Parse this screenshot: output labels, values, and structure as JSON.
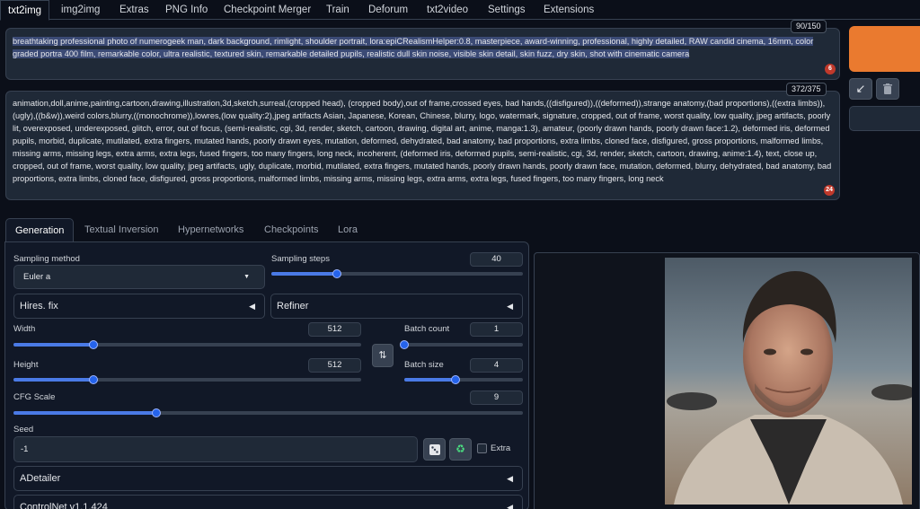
{
  "tabs": [
    "txt2img",
    "img2img",
    "Extras",
    "PNG Info",
    "Checkpoint Merger",
    "Train",
    "Deforum",
    "txt2video",
    "Settings",
    "Extensions"
  ],
  "prompt": {
    "text_selected": "breathtaking professional photo of numerogeek man, dark background, rimlight, shoulder portrait, lora:epiCRealismHelper:0.8, masterpiece, award-winning, professional, highly detailed, RAW candid cinema, 16mm, color graded portra 400 film, remarkable color, ultra realistic, textured skin, remarkable detailed pupils, realistic dull skin noise, visible skin detail, skin fuzz, dry skin, shot with cinematic camera",
    "token_counter": "90/150",
    "badge": "6"
  },
  "negative_prompt": {
    "text": "animation,doll,anime,painting,cartoon,drawing,illustration,3d,sketch,surreal,(cropped head), (cropped body),out of frame,crossed eyes, bad hands,((disfigured)),((deformed)),strange anatomy,(bad proportions),((extra limbs)),(ugly),((b&w)),weird colors,blurry,((monochrome)),lowres,(low quality:2),jpeg artifacts Asian, Japanese, Korean, Chinese, blurry, logo, watermark, signature, cropped, out of frame, worst quality, low quality, jpeg artifacts, poorly lit, overexposed, underexposed, glitch, error, out of focus, (semi-realistic, cgi, 3d, render, sketch, cartoon, drawing, digital art, anime, manga:1.3), amateur, (poorly drawn hands, poorly drawn face:1.2), deformed iris, deformed pupils, morbid, duplicate, mutilated, extra fingers, mutated hands, poorly drawn eyes, mutation, deformed, dehydrated, bad anatomy, bad proportions, extra limbs, cloned face, disfigured, gross proportions, malformed limbs, missing arms, missing legs, extra arms, extra legs, fused fingers, too many fingers, long neck, incoherent, (deformed iris, deformed pupils, semi-realistic, cgi, 3d, render, sketch, cartoon, drawing, anime:1.4), text, close up, cropped, out of frame, worst quality, low quality, jpeg artifacts, ugly, duplicate, morbid, mutilated, extra fingers, mutated hands, poorly drawn hands, poorly drawn face, mutation, deformed, blurry, dehydrated, bad anatomy, bad proportions, extra limbs, cloned face, disfigured, gross proportions, malformed limbs, missing arms, missing legs, extra arms, extra legs, fused fingers, too many fingers, long neck",
    "token_counter": "372/375",
    "badge": "24"
  },
  "subtabs": [
    "Generation",
    "Textual Inversion",
    "Hypernetworks",
    "Checkpoints",
    "Lora"
  ],
  "generation": {
    "sampling_method_label": "Sampling method",
    "sampling_method_value": "Euler a",
    "sampling_steps_label": "Sampling steps",
    "sampling_steps_value": "40",
    "sampling_steps_fraction": 0.26,
    "hires_label": "Hires. fix",
    "refiner_label": "Refiner",
    "width_label": "Width",
    "width_value": "512",
    "width_fraction": 0.23,
    "height_label": "Height",
    "height_value": "512",
    "height_fraction": 0.23,
    "batch_count_label": "Batch count",
    "batch_count_value": "1",
    "batch_count_fraction": 0.0,
    "batch_size_label": "Batch size",
    "batch_size_value": "4",
    "batch_size_fraction": 0.43,
    "cfg_label": "CFG Scale",
    "cfg_value": "9",
    "cfg_fraction": 0.28,
    "seed_label": "Seed",
    "seed_value": "-1",
    "extra_label": "Extra",
    "adetailer_label": "ADetailer",
    "controlnet_label": "ControlNet v1.1.424"
  },
  "colors": {
    "generate": "#ea7a2f",
    "slider": "#4a7ae6",
    "badge": "#c0392b"
  },
  "icons": {
    "dropdown": "chevron-down-icon",
    "collapse": "triangle-left-icon",
    "swap": "swap-arrows-icon",
    "dice": "dice-icon",
    "recycle": "recycle-icon",
    "arrow": "arrow-down-left-icon",
    "trash": "trash-icon"
  }
}
